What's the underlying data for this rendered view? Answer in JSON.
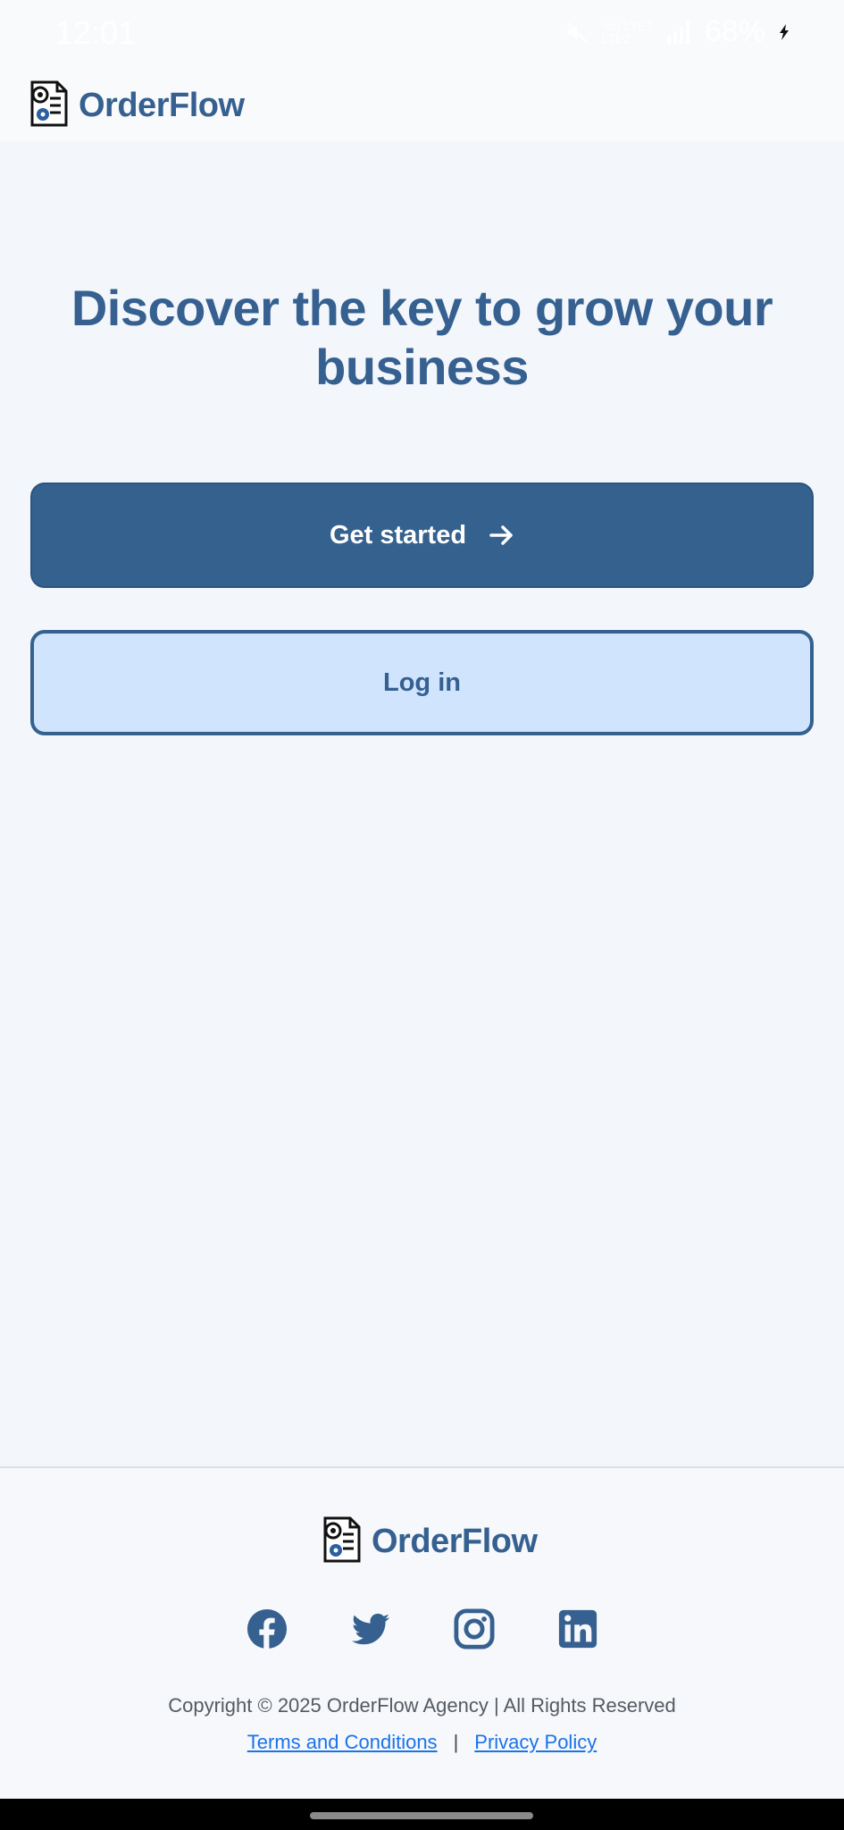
{
  "status_bar": {
    "time": "12:01",
    "network_label_top": "Vo) LTE1",
    "network_label_bottom": "LTE2",
    "battery": "68%"
  },
  "header": {
    "brand_name": "OrderFlow",
    "logo_icon": "document-gear-icon"
  },
  "hero": {
    "title": "Discover the key to grow your business"
  },
  "actions": {
    "get_started_label": "Get started",
    "get_started_icon": "arrow-right-icon",
    "login_label": "Log in"
  },
  "footer": {
    "brand_name": "OrderFlow",
    "social": [
      "facebook-icon",
      "twitter-icon",
      "instagram-icon",
      "linkedin-icon"
    ],
    "copyright": "Copyright © 2025 OrderFlow Agency | All Rights Reserved",
    "terms_label": "Terms and Conditions",
    "separator": "|",
    "privacy_label": "Privacy Policy"
  },
  "colors": {
    "brand": "#356090",
    "primary_button": "#35618e",
    "secondary_button_bg": "#d1e4fd",
    "link": "#1a73e8",
    "background": "#f3f6fb"
  }
}
